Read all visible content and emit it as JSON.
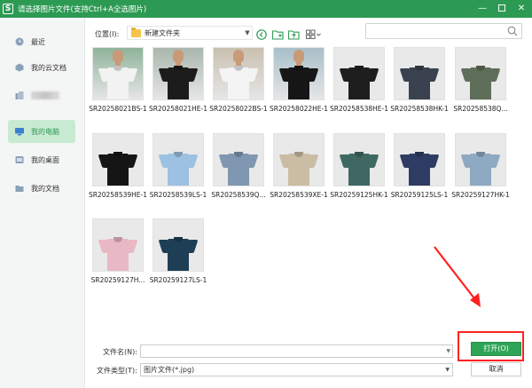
{
  "window": {
    "title": "请选择图片文件(支持Ctrl+A全选图片)",
    "logo_char": "S",
    "accent": "#2d9a54"
  },
  "sidebar": {
    "items": [
      {
        "label": "最近",
        "icon": "clock-icon"
      },
      {
        "label": "我的云文档",
        "icon": "cloud-doc-icon"
      },
      {
        "label": "",
        "icon": "blurred-item-icon",
        "blurred": true
      },
      {
        "label": "我的电脑",
        "icon": "computer-icon",
        "active": true
      },
      {
        "label": "我的桌面",
        "icon": "desktop-icon"
      },
      {
        "label": "我的文档",
        "icon": "folder-icon"
      }
    ]
  },
  "toolbar": {
    "location_label": "位置(I):",
    "path": "新建文件夹",
    "icons": [
      "back-icon",
      "new-folder-icon",
      "upload-folder-icon",
      "view-mode-icon"
    ],
    "search_placeholder": ""
  },
  "files": [
    {
      "name": "SR20258021BS-1",
      "shirt": "#f2f2f2",
      "bg": "#8fb39a"
    },
    {
      "name": "SR20258021HE-1",
      "shirt": "#1c1c1c",
      "bg": "#a9b6ad"
    },
    {
      "name": "SR20258022BS-1",
      "shirt": "#f4f4f4",
      "bg": "#c9c0b0"
    },
    {
      "name": "SR20258022HE-1",
      "shirt": "#161616",
      "bg": "#a8bfc9"
    },
    {
      "name": "SR20258538HE-1",
      "shirt": "#1e1e1e",
      "bg": "#ececec"
    },
    {
      "name": "SR20258538HK-1",
      "shirt": "#3a4250",
      "bg": "#ececec"
    },
    {
      "name": "SR20258538Q...",
      "shirt": "#5f6e58",
      "bg": "#ececec"
    },
    {
      "name": "SR20258539HE-1",
      "shirt": "#151515",
      "bg": "#ececec"
    },
    {
      "name": "SR20258539LS-1",
      "shirt": "#9cc1e2",
      "bg": "#ececec"
    },
    {
      "name": "SR20258539Q...",
      "shirt": "#7f97b0",
      "bg": "#ececec"
    },
    {
      "name": "SR20258539XE-1",
      "shirt": "#cbbca4",
      "bg": "#ececec"
    },
    {
      "name": "SR20259125HK-1",
      "shirt": "#3f6863",
      "bg": "#ececec"
    },
    {
      "name": "SR20259125LS-1",
      "shirt": "#2e3b63",
      "bg": "#ececec"
    },
    {
      "name": "SR20259127HK-1",
      "shirt": "#8ea9c2",
      "bg": "#ececec"
    },
    {
      "name": "SR20259127H...",
      "shirt": "#e8b8c4",
      "bg": "#ececec"
    },
    {
      "name": "SR20259127LS-1",
      "shirt": "#1e3e55",
      "bg": "#ececec"
    }
  ],
  "footer": {
    "filename_label": "文件名(N):",
    "filename_value": "",
    "filetype_label": "文件类型(T):",
    "filetype_value": "图片文件(*.jpg)",
    "open_label": "打开(O)",
    "cancel_label": "取消"
  }
}
